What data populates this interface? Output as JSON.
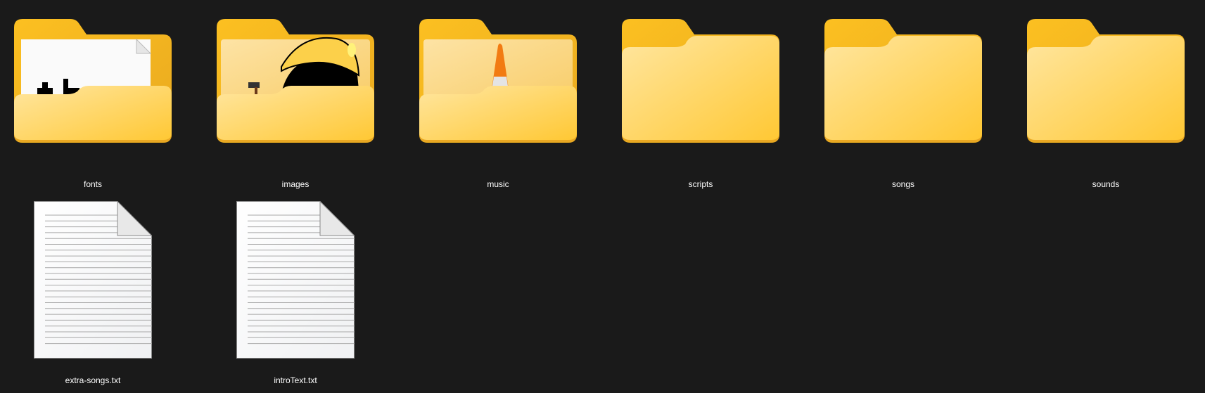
{
  "items": [
    {
      "name": "fonts",
      "type": "folder",
      "preview": "font-file"
    },
    {
      "name": "images",
      "type": "folder",
      "preview": "image"
    },
    {
      "name": "music",
      "type": "folder",
      "preview": "vlc-media"
    },
    {
      "name": "scripts",
      "type": "folder",
      "preview": "empty"
    },
    {
      "name": "songs",
      "type": "folder",
      "preview": "empty"
    },
    {
      "name": "sounds",
      "type": "folder",
      "preview": "empty"
    },
    {
      "name": "extra-songs.txt",
      "type": "text-file",
      "preview": "text-document"
    },
    {
      "name": "introText.txt",
      "type": "text-file",
      "preview": "text-document"
    }
  ],
  "colors": {
    "background": "#1a1a1a",
    "folder_back": "#f4b41e",
    "folder_front": "#ffd35a",
    "label": "#ffffff"
  }
}
